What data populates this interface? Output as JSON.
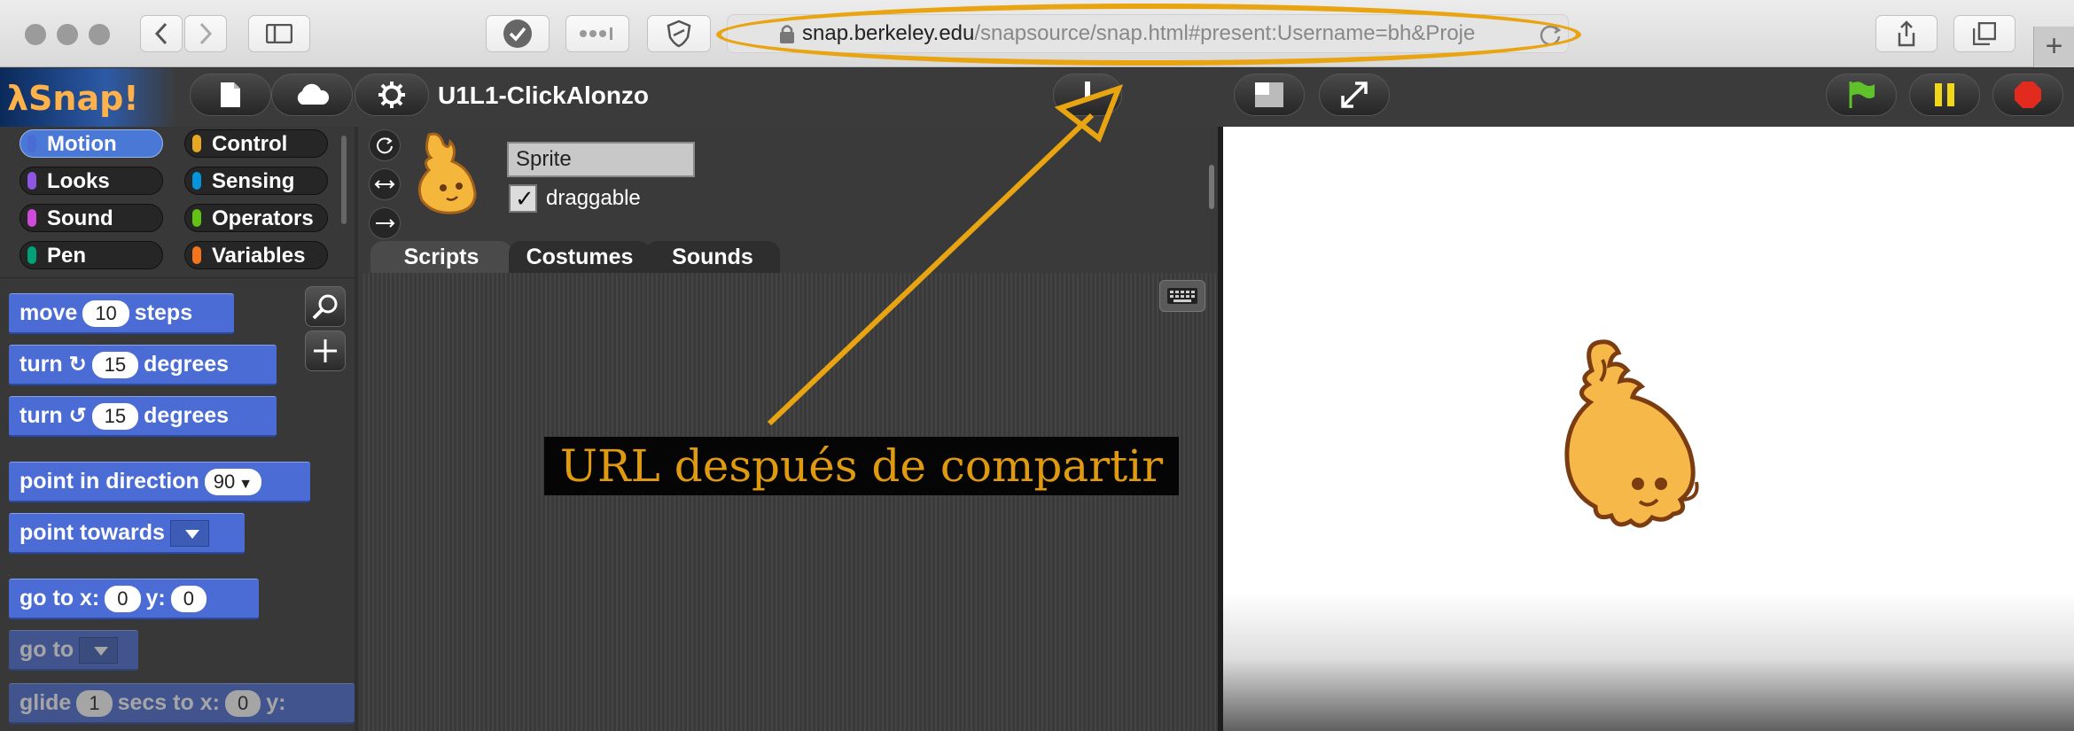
{
  "browser": {
    "url_host": "snap.berkeley.edu",
    "url_path": "/snapsource/snap.html#present:Username=bh&Proje",
    "new_tab_icon": "plus-icon"
  },
  "snap": {
    "logo": "λSnap!",
    "project_title": "U1L1-ClickAlonzo",
    "categories": [
      {
        "label": "Motion",
        "color": "#4a6cd4",
        "selected": true
      },
      {
        "label": "Control",
        "color": "#e6a822",
        "selected": false
      },
      {
        "label": "Looks",
        "color": "#8f56e3",
        "selected": false
      },
      {
        "label": "Sensing",
        "color": "#0494dc",
        "selected": false
      },
      {
        "label": "Sound",
        "color": "#cf4ad9",
        "selected": false
      },
      {
        "label": "Operators",
        "color": "#62c213",
        "selected": false
      },
      {
        "label": "Pen",
        "color": "#00a178",
        "selected": false
      },
      {
        "label": "Variables",
        "color": "#f3761d",
        "selected": false
      }
    ],
    "blocks": {
      "move": {
        "pre": "move",
        "value": "10",
        "post": "steps"
      },
      "turn_cw": {
        "pre": "turn",
        "value": "15",
        "post": "degrees"
      },
      "turn_ccw": {
        "pre": "turn",
        "value": "15",
        "post": "degrees"
      },
      "point_dir": {
        "pre": "point in direction",
        "value": "90"
      },
      "point_towards": {
        "pre": "point towards"
      },
      "goto_xy": {
        "pre": "go to x:",
        "x": "0",
        "ylabel": "y:",
        "y": "0"
      },
      "goto": {
        "pre": "go to"
      },
      "glide": {
        "pre": "glide",
        "value": "1",
        "mid": "secs to x:",
        "x": "0",
        "post": "y:"
      }
    },
    "sprite": {
      "name": "Sprite",
      "draggable_label": "draggable",
      "draggable_checked": "✓"
    },
    "tabs": [
      "Scripts",
      "Costumes",
      "Sounds"
    ]
  },
  "annotation": {
    "text": "URL después  de compartir",
    "color": "#e9a412"
  }
}
